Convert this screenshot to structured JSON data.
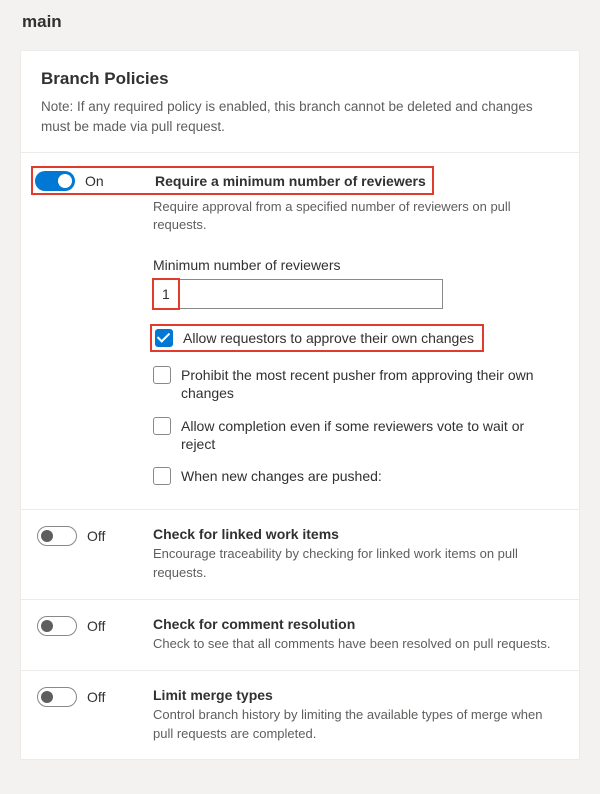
{
  "page": {
    "title": "main"
  },
  "header": {
    "title": "Branch Policies",
    "note": "Note: If any required policy is enabled, this branch cannot be deleted and changes must be made via pull request."
  },
  "toggle_states": {
    "on_label": "On",
    "off_label": "Off"
  },
  "policies": {
    "reviewers": {
      "title": "Require a minimum number of reviewers",
      "desc": "Require approval from a specified number of reviewers on pull requests.",
      "field_label": "Minimum number of reviewers",
      "value": "1",
      "options": {
        "allow_self": "Allow requestors to approve their own changes",
        "prohibit_pusher": "Prohibit the most recent pusher from approving their own changes",
        "allow_completion": "Allow completion even if some reviewers vote to wait or reject",
        "new_changes": "When new changes are pushed:"
      }
    },
    "work_items": {
      "title": "Check for linked work items",
      "desc": "Encourage traceability by checking for linked work items on pull requests."
    },
    "comment_resolution": {
      "title": "Check for comment resolution",
      "desc": "Check to see that all comments have been resolved on pull requests."
    },
    "merge_types": {
      "title": "Limit merge types",
      "desc": "Control branch history by limiting the available types of merge when pull requests are completed."
    }
  }
}
